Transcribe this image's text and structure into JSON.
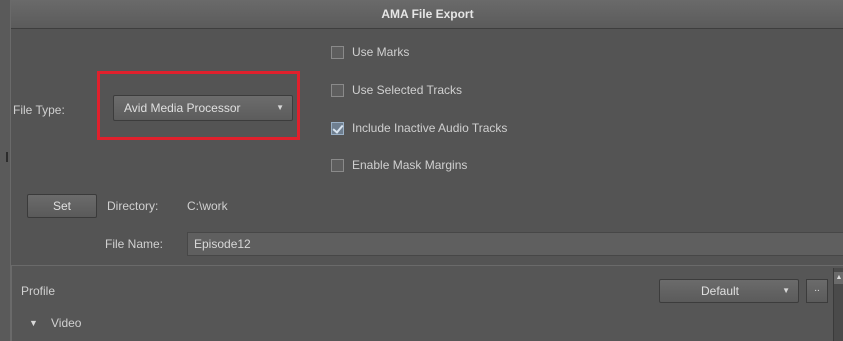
{
  "dialog": {
    "title": "AMA File Export"
  },
  "file_type": {
    "label": "File Type:",
    "selected": "Avid Media Processor"
  },
  "options": [
    {
      "label": "Use Marks",
      "checked": false
    },
    {
      "label": "Use Selected Tracks",
      "checked": false
    },
    {
      "label": "Include Inactive Audio Tracks",
      "checked": true
    },
    {
      "label": "Enable Mask Margins",
      "checked": false
    }
  ],
  "directory": {
    "set_label": "Set",
    "label": "Directory:",
    "value": "C:\\work"
  },
  "file_name": {
    "label": "File Name:",
    "value": "Episode12"
  },
  "profile": {
    "label": "Profile",
    "selected": "Default",
    "more_label": "..",
    "section": "Video"
  }
}
